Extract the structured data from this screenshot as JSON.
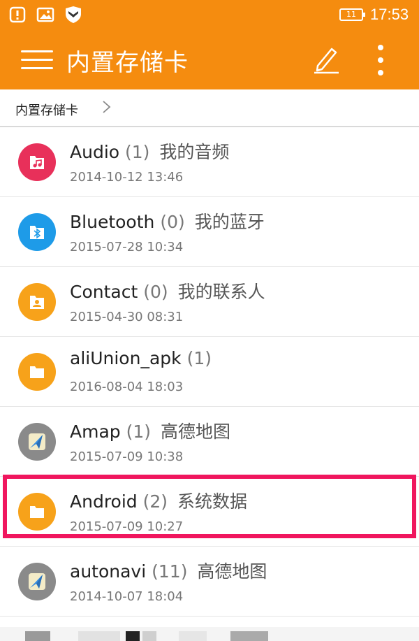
{
  "status_bar": {
    "time": "17:53",
    "battery": "11",
    "icons": [
      "alert-icon",
      "image-icon",
      "shield-icon"
    ]
  },
  "app_bar": {
    "title": "内置存储卡",
    "icons": [
      "menu-icon",
      "edit-icon",
      "more-vert-icon"
    ],
    "color": "#f58c0f"
  },
  "breadcrumb": {
    "items": [
      "内置存储卡"
    ]
  },
  "folders": [
    {
      "name": "Audio",
      "count": "(1)",
      "desc": "我的音频",
      "date": "2014-10-12 13:46",
      "icon": "music-folder-icon"
    },
    {
      "name": "Bluetooth",
      "count": "(0)",
      "desc": "我的蓝牙",
      "date": "2015-07-28 10:34",
      "icon": "bluetooth-folder-icon"
    },
    {
      "name": "Contact",
      "count": "(0)",
      "desc": "我的联系人",
      "date": "2015-04-30 08:31",
      "icon": "contact-folder-icon"
    },
    {
      "name": "aliUnion_apk",
      "count": "(1)",
      "desc": "",
      "date": "2016-08-04 18:03",
      "icon": "folder-icon"
    },
    {
      "name": "Amap",
      "count": "(1)",
      "desc": "高德地图",
      "date": "2015-07-09 10:38",
      "icon": "amap-app-icon"
    },
    {
      "name": "Android",
      "count": "(2)",
      "desc": "系统数据",
      "date": "2015-07-09 10:27",
      "icon": "folder-icon"
    },
    {
      "name": "autonavi",
      "count": "(11)",
      "desc": "高德地图",
      "date": "2014-10-07 18:04",
      "icon": "amap-app-icon"
    }
  ],
  "highlighted_row": "Android",
  "colors": {
    "accent": "#f58c0f",
    "highlight": "#f0165e",
    "audio": "#e8305a",
    "bluetooth": "#1e9be8",
    "folder": "#f7a21a",
    "app_gray": "#8a8a8a"
  }
}
